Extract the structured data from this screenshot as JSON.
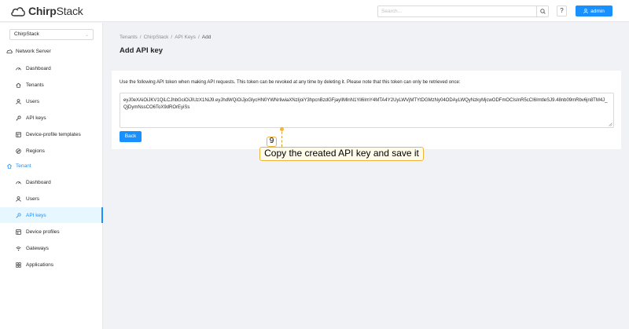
{
  "header": {
    "logo_text_bold": "Chirp",
    "logo_text_rest": "Stack",
    "search_placeholder": "Search...",
    "help_label": "?",
    "user_label": "admin"
  },
  "sidebar": {
    "tenant_selected": "ChirpStack",
    "network_server_label": "Network Server",
    "network_server_items": [
      {
        "label": "Dashboard",
        "icon": "dashboard-icon"
      },
      {
        "label": "Tenants",
        "icon": "home-icon"
      },
      {
        "label": "Users",
        "icon": "user-icon"
      },
      {
        "label": "API keys",
        "icon": "key-icon"
      },
      {
        "label": "Device-profile templates",
        "icon": "template-icon"
      },
      {
        "label": "Regions",
        "icon": "compass-icon"
      }
    ],
    "tenant_label": "Tenant",
    "tenant_items": [
      {
        "label": "Dashboard",
        "icon": "dashboard-icon"
      },
      {
        "label": "Users",
        "icon": "user-icon"
      },
      {
        "label": "API keys",
        "icon": "key-icon",
        "active": true
      },
      {
        "label": "Device profiles",
        "icon": "template-icon"
      },
      {
        "label": "Gateways",
        "icon": "wifi-icon"
      },
      {
        "label": "Applications",
        "icon": "appstore-icon"
      }
    ]
  },
  "main": {
    "breadcrumb": [
      "Tenants",
      "ChirpStack",
      "API Keys",
      "Add"
    ],
    "title": "Add API key",
    "info_text": "Use the following API token when making API requests. This token can be revoked at any time by deleting it. Please note that this token can only be retrieved once:",
    "token": "eyJ0eXAiOiJKV1QiLCJhbGciOiJIUzX1NiJ9.eyJhdWQiOiJjoGlycHN0YWNrIiwiaXNzIjoiY3hpcnBzdGFjayIlMlnN1Yil6ImY4MTA4Y2UyLWVjMTYtDGMzNy04ODAyLWQyNzkyMjcwODFmOCIsInR5cCI6ImtleSJ9.48nb09mRbv6jn8TM4J_QjDymNssCO6ToX9dROrEyiSs",
    "back_label": "Back"
  },
  "annotation": {
    "step_number": "9",
    "text": "Copy the created API key and save it"
  },
  "colors": {
    "accent": "#1890ff",
    "annotation": "#f0b43a"
  }
}
